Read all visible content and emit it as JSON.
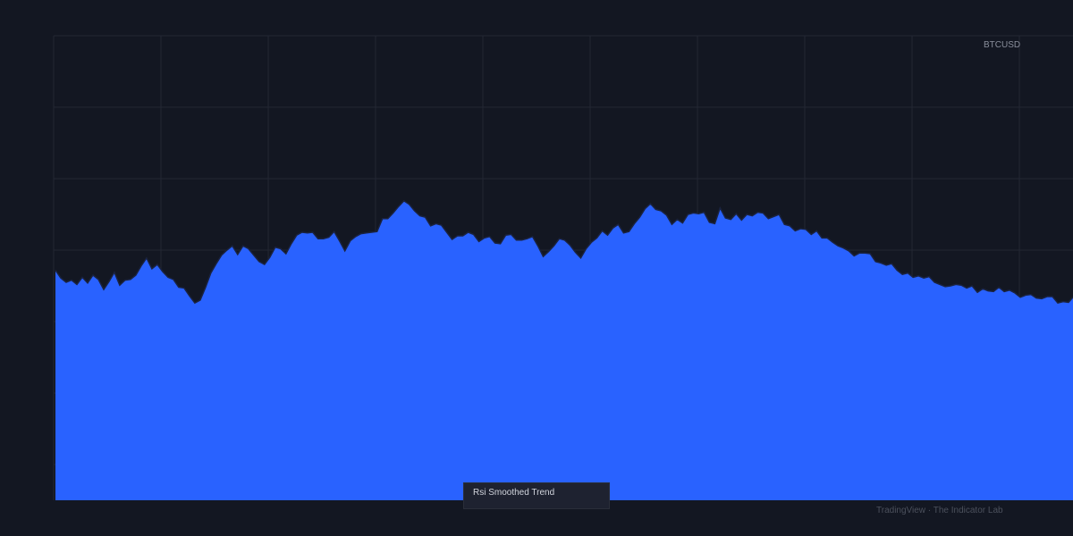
{
  "header": {
    "symbol": "BTCUSD"
  },
  "legend": {
    "label": "Rsi Smoothed Trend"
  },
  "footer": {
    "watermark": "TradingView · The Indicator Lab"
  },
  "colors": {
    "background": "#131722",
    "grid": "#232733",
    "fill": "#2962ff",
    "line": "#1a2340"
  },
  "chart_data": {
    "type": "area",
    "title": "",
    "xlabel": "",
    "ylabel": "",
    "ylim": [
      0,
      65
    ],
    "grid": true,
    "legend": "bottom-center",
    "series": [
      {
        "name": "Rsi Smoothed Trend",
        "points": [
          [
            0,
            32.2
          ],
          [
            6,
            31.1
          ],
          [
            12,
            30.5
          ],
          [
            18,
            30.8
          ],
          [
            24,
            30.2
          ],
          [
            30,
            31.2
          ],
          [
            36,
            30.4
          ],
          [
            42,
            31.5
          ],
          [
            48,
            30.9
          ],
          [
            54,
            29.5
          ],
          [
            60,
            30.6
          ],
          [
            66,
            31.9
          ],
          [
            72,
            30.1
          ],
          [
            78,
            30.8
          ],
          [
            84,
            30.9
          ],
          [
            90,
            31.5
          ],
          [
            96,
            32.8
          ],
          [
            102,
            33.9
          ],
          [
            108,
            32.4
          ],
          [
            114,
            33.0
          ],
          [
            120,
            32.0
          ],
          [
            126,
            31.2
          ],
          [
            132,
            30.9
          ],
          [
            138,
            29.8
          ],
          [
            144,
            29.7
          ],
          [
            150,
            28.6
          ],
          [
            156,
            27.6
          ],
          [
            162,
            28.0
          ],
          [
            168,
            29.8
          ],
          [
            174,
            31.8
          ],
          [
            180,
            33.1
          ],
          [
            186,
            34.3
          ],
          [
            192,
            35.0
          ],
          [
            198,
            35.6
          ],
          [
            204,
            34.4
          ],
          [
            210,
            35.6
          ],
          [
            216,
            35.2
          ],
          [
            222,
            34.3
          ],
          [
            228,
            33.4
          ],
          [
            234,
            33.0
          ],
          [
            240,
            34.0
          ],
          [
            246,
            35.4
          ],
          [
            252,
            35.2
          ],
          [
            258,
            34.5
          ],
          [
            264,
            35.9
          ],
          [
            270,
            37.1
          ],
          [
            276,
            37.5
          ],
          [
            282,
            37.4
          ],
          [
            288,
            37.5
          ],
          [
            294,
            36.6
          ],
          [
            300,
            36.6
          ],
          [
            306,
            36.8
          ],
          [
            312,
            37.6
          ],
          [
            318,
            36.3
          ],
          [
            324,
            34.9
          ],
          [
            330,
            36.3
          ],
          [
            336,
            36.9
          ],
          [
            342,
            37.3
          ],
          [
            348,
            37.4
          ],
          [
            354,
            37.5
          ],
          [
            360,
            37.6
          ],
          [
            366,
            39.4
          ],
          [
            372,
            39.4
          ],
          [
            378,
            40.2
          ],
          [
            384,
            41.1
          ],
          [
            390,
            41.9
          ],
          [
            396,
            41.4
          ],
          [
            402,
            40.5
          ],
          [
            408,
            39.8
          ],
          [
            414,
            39.6
          ],
          [
            420,
            38.4
          ],
          [
            426,
            38.7
          ],
          [
            432,
            38.5
          ],
          [
            438,
            37.5
          ],
          [
            444,
            36.5
          ],
          [
            450,
            37.0
          ],
          [
            456,
            37.0
          ],
          [
            462,
            37.5
          ],
          [
            468,
            37.2
          ],
          [
            474,
            36.2
          ],
          [
            480,
            36.7
          ],
          [
            486,
            36.9
          ],
          [
            492,
            36.0
          ],
          [
            498,
            35.9
          ],
          [
            504,
            37.1
          ],
          [
            510,
            37.2
          ],
          [
            516,
            36.4
          ],
          [
            522,
            36.4
          ],
          [
            528,
            36.6
          ],
          [
            534,
            36.9
          ],
          [
            540,
            35.6
          ],
          [
            546,
            34.1
          ],
          [
            552,
            34.8
          ],
          [
            558,
            35.6
          ],
          [
            564,
            36.6
          ],
          [
            570,
            36.4
          ],
          [
            576,
            35.7
          ],
          [
            582,
            34.7
          ],
          [
            588,
            33.9
          ],
          [
            594,
            35.2
          ],
          [
            600,
            36.1
          ],
          [
            606,
            36.7
          ],
          [
            612,
            37.7
          ],
          [
            618,
            37.1
          ],
          [
            624,
            38.1
          ],
          [
            630,
            38.6
          ],
          [
            636,
            37.4
          ],
          [
            642,
            37.6
          ],
          [
            648,
            38.7
          ],
          [
            654,
            39.6
          ],
          [
            660,
            40.8
          ],
          [
            666,
            41.5
          ],
          [
            672,
            40.7
          ],
          [
            678,
            40.5
          ],
          [
            684,
            39.9
          ],
          [
            690,
            38.6
          ],
          [
            696,
            39.3
          ],
          [
            702,
            38.8
          ],
          [
            708,
            40.0
          ],
          [
            714,
            40.2
          ],
          [
            720,
            40.1
          ],
          [
            726,
            40.3
          ],
          [
            732,
            38.9
          ],
          [
            738,
            38.7
          ],
          [
            744,
            40.9
          ],
          [
            750,
            39.5
          ],
          [
            756,
            39.3
          ],
          [
            762,
            40.1
          ],
          [
            768,
            39.2
          ],
          [
            774,
            40.0
          ],
          [
            780,
            39.8
          ],
          [
            786,
            40.3
          ],
          [
            792,
            40.2
          ],
          [
            798,
            39.4
          ],
          [
            804,
            39.7
          ],
          [
            810,
            40.0
          ],
          [
            816,
            38.6
          ],
          [
            822,
            38.4
          ],
          [
            828,
            37.7
          ],
          [
            834,
            38.0
          ],
          [
            840,
            37.9
          ],
          [
            846,
            37.2
          ],
          [
            852,
            37.7
          ],
          [
            858,
            36.7
          ],
          [
            864,
            36.7
          ],
          [
            870,
            36.1
          ],
          [
            876,
            35.6
          ],
          [
            882,
            35.3
          ],
          [
            888,
            34.9
          ],
          [
            894,
            34.2
          ],
          [
            900,
            34.6
          ],
          [
            906,
            34.6
          ],
          [
            912,
            34.5
          ],
          [
            918,
            33.4
          ],
          [
            924,
            33.2
          ],
          [
            930,
            32.9
          ],
          [
            936,
            33.1
          ],
          [
            942,
            32.2
          ],
          [
            948,
            31.6
          ],
          [
            954,
            31.8
          ],
          [
            960,
            31.2
          ],
          [
            966,
            31.4
          ],
          [
            972,
            31.1
          ],
          [
            978,
            31.3
          ],
          [
            984,
            30.5
          ],
          [
            990,
            30.2
          ],
          [
            996,
            29.9
          ],
          [
            1002,
            30.0
          ],
          [
            1008,
            30.2
          ],
          [
            1014,
            30.1
          ],
          [
            1020,
            29.7
          ],
          [
            1026,
            30.0
          ],
          [
            1032,
            29.1
          ],
          [
            1038,
            29.6
          ],
          [
            1044,
            29.3
          ],
          [
            1050,
            29.2
          ],
          [
            1056,
            29.8
          ],
          [
            1062,
            29.2
          ],
          [
            1068,
            29.4
          ],
          [
            1074,
            29.0
          ],
          [
            1080,
            28.4
          ],
          [
            1086,
            28.7
          ],
          [
            1092,
            28.8
          ],
          [
            1098,
            28.3
          ],
          [
            1104,
            28.2
          ],
          [
            1110,
            28.5
          ],
          [
            1116,
            28.5
          ],
          [
            1122,
            27.6
          ],
          [
            1128,
            27.8
          ],
          [
            1134,
            27.7
          ],
          [
            1139,
            28.4
          ]
        ]
      }
    ]
  }
}
